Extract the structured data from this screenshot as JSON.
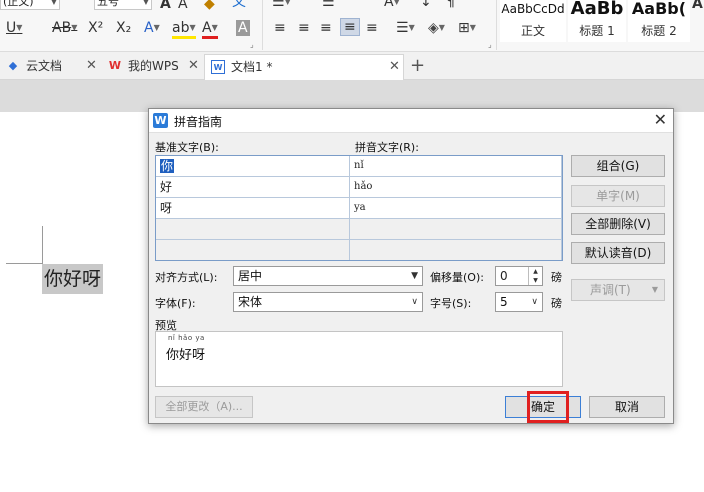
{
  "ribbon": {
    "font_name_value": "(正文)",
    "font_size_value": "五号",
    "bold_glyph": "A",
    "italic_glyph": "A",
    "underline_glyph": "U",
    "strike_glyph": "AB",
    "superscript_glyph": "X²",
    "subscript_glyph": "X₂",
    "text_effect_glyph": "A",
    "highlight_glyph": "ab",
    "font_color_glyph": "A",
    "char_shading_glyph": "A",
    "styles": [
      {
        "sample": "AaBbCcDd",
        "name": "正文"
      },
      {
        "sample": "AaBb",
        "name": "标题 1"
      },
      {
        "sample": "AaBb(",
        "name": "标题 2"
      }
    ]
  },
  "tabs": [
    {
      "label": "云文档"
    },
    {
      "label": "我的WPS"
    },
    {
      "label": "文档1 *"
    }
  ],
  "document": {
    "text": "你好呀"
  },
  "dialog": {
    "title": "拼音指南",
    "base_text_label": "基准文字(B):",
    "ruby_text_label": "拼音文字(R):",
    "rows": [
      {
        "base_pre": "",
        "base_sel": "你",
        "ruby": "nǐ"
      },
      {
        "base_pre": "好",
        "base_sel": "",
        "ruby": "hǎo"
      },
      {
        "base_pre": "呀",
        "base_sel": "",
        "ruby": "ya"
      },
      {
        "base_pre": "",
        "base_sel": "",
        "ruby": ""
      },
      {
        "base_pre": "",
        "base_sel": "",
        "ruby": ""
      }
    ],
    "buttons": {
      "group": "组合(G)",
      "mono": "单字(M)",
      "clear_all": "全部删除(V)",
      "default_reading": "默认读音(D)",
      "tone": "声调(T)",
      "change_all": "全部更改（A)...",
      "ok": "确定",
      "cancel": "取消"
    },
    "alignment_label": "对齐方式(L):",
    "alignment_value": "居中",
    "offset_label": "偏移量(O):",
    "offset_value": "0",
    "offset_unit": "磅",
    "font_label": "字体(F):",
    "font_value": "宋体",
    "size_label": "字号(S):",
    "size_value": "5",
    "size_unit": "磅",
    "preview_label": "预览",
    "preview_pinyin": "nǐ hǎo ya",
    "preview_text": "你好呀"
  }
}
